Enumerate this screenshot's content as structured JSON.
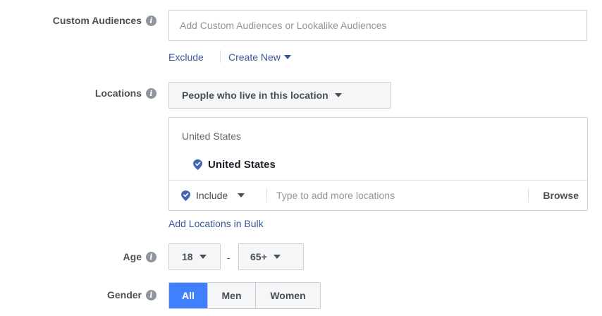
{
  "custom_audiences": {
    "label": "Custom Audiences",
    "placeholder": "Add Custom Audiences or Lookalike Audiences",
    "value": "",
    "exclude_label": "Exclude",
    "create_new_label": "Create New"
  },
  "locations": {
    "label": "Locations",
    "type_dropdown": "People who live in this location",
    "header": "United States",
    "selected": [
      {
        "name": "United States"
      }
    ],
    "include_label": "Include",
    "search_placeholder": "Type to add more locations",
    "browse_label": "Browse",
    "add_bulk_label": "Add Locations in Bulk"
  },
  "age": {
    "label": "Age",
    "min": "18",
    "separator": "-",
    "max": "65+"
  },
  "gender": {
    "label": "Gender",
    "options": [
      "All",
      "Men",
      "Women"
    ],
    "selected": "All"
  },
  "colors": {
    "link": "#365899",
    "pin": "#4267b2",
    "active_button": "#4080ff"
  },
  "icons": {
    "info": "info-icon",
    "location_pin": "location-pin-icon",
    "caret": "caret-down-icon"
  }
}
